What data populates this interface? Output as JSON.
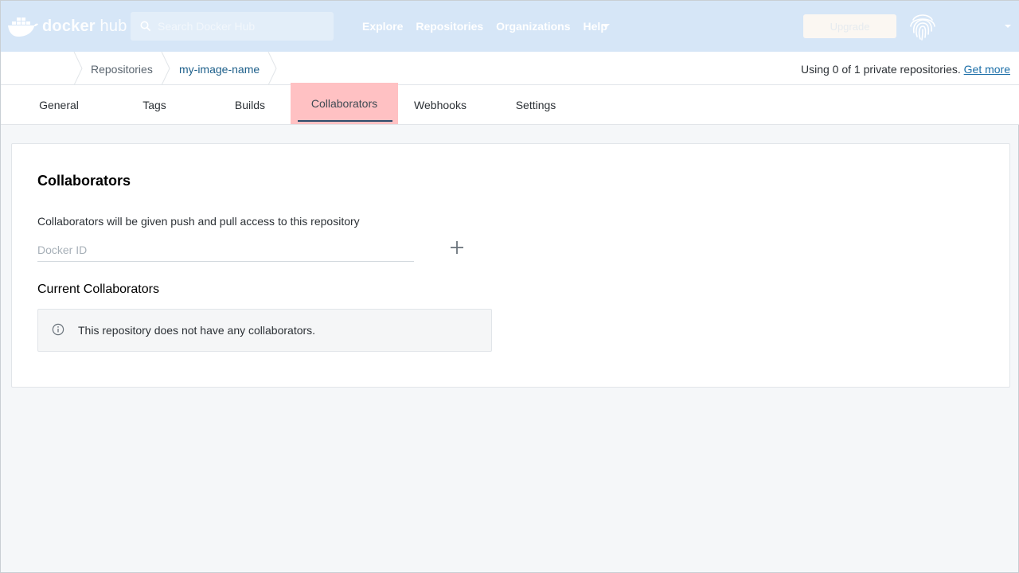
{
  "header": {
    "logo_text_bold": "docker",
    "logo_text_rest": " hub",
    "search_placeholder": "Search Docker Hub",
    "nav_links": [
      "Explore",
      "Repositories",
      "Organizations",
      "Help"
    ],
    "upgrade_label": "Upgrade"
  },
  "breadcrumb": {
    "items": [
      "Repositories",
      "my-image-name"
    ],
    "usage_text": "Using 0 of 1 private repositories.",
    "usage_link": "Get more"
  },
  "tabs": [
    "General",
    "Tags",
    "Builds",
    "Collaborators",
    "Webhooks",
    "Settings"
  ],
  "active_tab": "Collaborators",
  "collaborators": {
    "title": "Collaborators",
    "description": "Collaborators will be given push and pull access to this repository",
    "input_placeholder": "Docker ID",
    "current_title": "Current Collaborators",
    "empty_message": "This repository does not have any collaborators."
  },
  "colors": {
    "header_bg": "#d6e6f7",
    "active_tab_highlight": "#ffc1c3",
    "link": "#1c6fa8"
  },
  "icons": [
    "docker-whale-logo",
    "search-icon",
    "fingerprint-avatar",
    "plus-icon",
    "info-icon"
  ]
}
